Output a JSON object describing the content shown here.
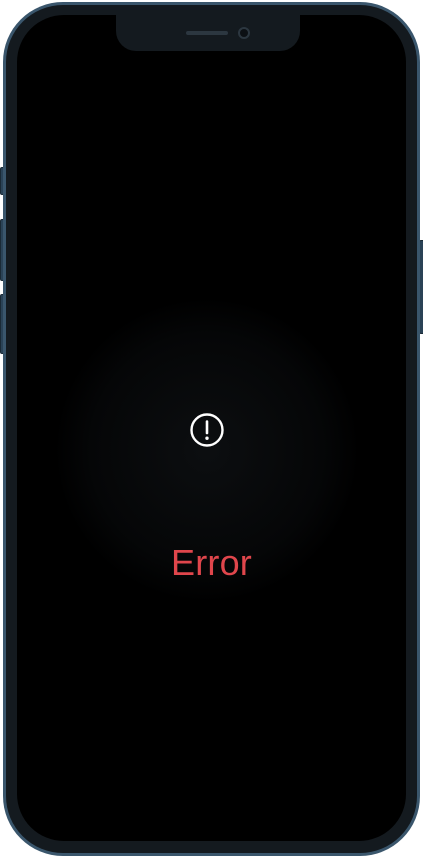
{
  "screen": {
    "icon": "exclamation-circle-icon",
    "message": "Error",
    "message_color": "#e0464c",
    "background_color": "#000000"
  },
  "device": {
    "frame_color": "#3a566c"
  }
}
